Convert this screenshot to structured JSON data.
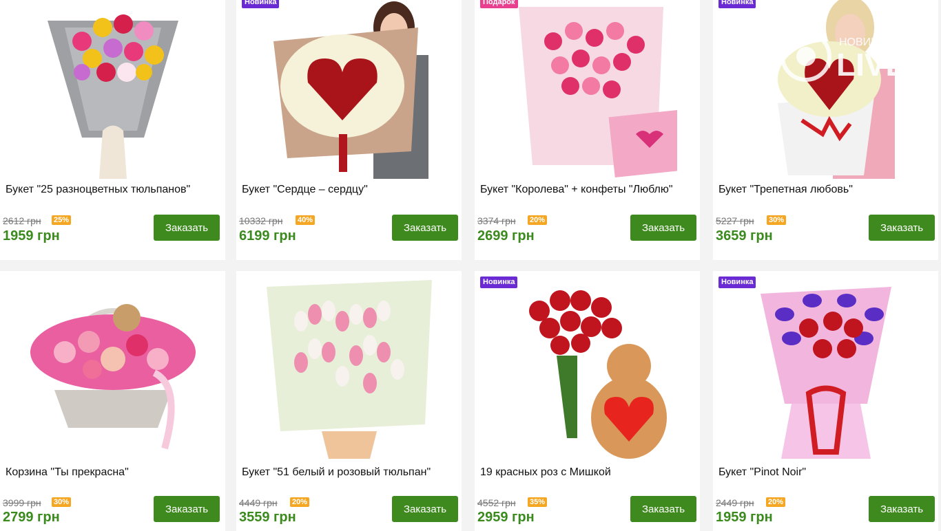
{
  "colors": {
    "price_green": "#3b8a1e",
    "button_green": "#3f8a1f",
    "badge_purple": "#6a2bd4",
    "badge_pink": "#e8408f",
    "discount_orange": "#f5a623"
  },
  "watermark": {
    "top_text": "НОВИНИ",
    "main_text": "LIVE"
  },
  "products": [
    {
      "title": "Букет \"25 разноцветных тюльпанов\"",
      "badge": "",
      "old_price": "2612 грн",
      "discount": "25%",
      "price": "1959 грн",
      "button": "Заказать",
      "image": "tulip-bouquet-gray-wrap"
    },
    {
      "title": "Букет \"Сердце – сердцу\"",
      "badge": "Новинка",
      "old_price": "10332 грн",
      "discount": "40%",
      "price": "6199 грн",
      "button": "Заказать",
      "image": "heart-roses-woman"
    },
    {
      "title": "Букет \"Королева\" + конфеты \"Люблю\"",
      "badge": "Подарок",
      "old_price": "3374 грн",
      "discount": "20%",
      "price": "2699 грн",
      "button": "Заказать",
      "image": "pink-roses-candy-box"
    },
    {
      "title": "Букет \"Трепетная любовь\"",
      "badge": "Новинка",
      "old_price": "5227 грн",
      "discount": "30%",
      "price": "3659 грн",
      "button": "Заказать",
      "image": "heart-roses-woman-2"
    },
    {
      "title": "Корзина \"Ты прекрасна\"",
      "badge": "",
      "old_price": "3999 грн",
      "discount": "30%",
      "price": "2799 грн",
      "button": "Заказать",
      "image": "basket-pink-roses-teddy"
    },
    {
      "title": "Букет \"51 белый и розовый тюльпан\"",
      "badge": "",
      "old_price": "4449 грн",
      "discount": "20%",
      "price": "3559 грн",
      "button": "Заказать",
      "image": "white-pink-tulips"
    },
    {
      "title": "19 красных роз с Мишкой",
      "badge": "Новинка",
      "old_price": "4552 грн",
      "discount": "35%",
      "price": "2959 грн",
      "button": "Заказать",
      "image": "red-roses-teddy-bear"
    },
    {
      "title": "Букет \"Pinot Noir\"",
      "badge": "Новинка",
      "old_price": "2449 грн",
      "discount": "20%",
      "price": "1959 грн",
      "button": "Заказать",
      "image": "roses-irises-pink-wrap"
    }
  ]
}
